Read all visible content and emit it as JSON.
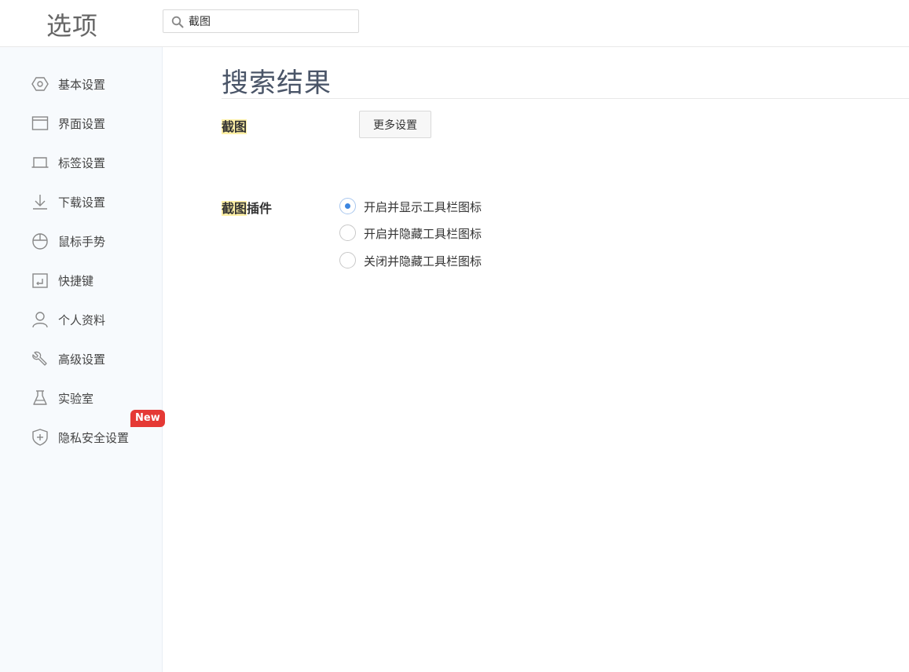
{
  "app_title": "选项",
  "search": {
    "value": "截图",
    "icon": "search-icon"
  },
  "sidebar": {
    "items": [
      {
        "label": "基本设置",
        "icon": "hexagon-settings-icon"
      },
      {
        "label": "界面设置",
        "icon": "window-icon"
      },
      {
        "label": "标签设置",
        "icon": "tab-icon"
      },
      {
        "label": "下载设置",
        "icon": "download-icon"
      },
      {
        "label": "鼠标手势",
        "icon": "mouse-icon"
      },
      {
        "label": "快捷键",
        "icon": "shortcut-key-icon"
      },
      {
        "label": "个人资料",
        "icon": "user-icon"
      },
      {
        "label": "高级设置",
        "icon": "wrench-icon"
      },
      {
        "label": "实验室",
        "icon": "flask-icon"
      },
      {
        "label": "隐私安全设置",
        "icon": "shield-plus-icon",
        "badge": "New"
      }
    ]
  },
  "main": {
    "title": "搜索结果",
    "screenshot_row": {
      "label_highlight": "截图",
      "button": "更多设置"
    },
    "plugin_row": {
      "label_highlight": "截图",
      "label_rest": "插件",
      "options": [
        {
          "label": "开启并显示工具栏图标",
          "checked": true
        },
        {
          "label": "开启并隐藏工具栏图标",
          "checked": false
        },
        {
          "label": "关闭并隐藏工具栏图标",
          "checked": false
        }
      ]
    }
  },
  "colors": {
    "sidebar_bg": "#f7fafd",
    "highlight": "#fff0a6",
    "radio_accent": "#3c86e0",
    "badge": "#e53935"
  }
}
